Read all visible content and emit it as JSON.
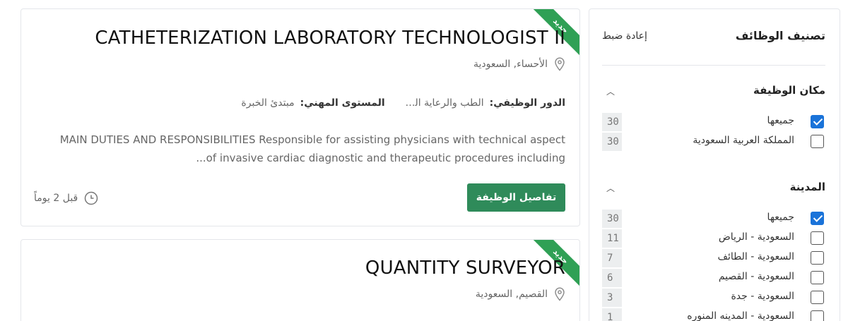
{
  "filters": {
    "title": "تصنيف الوظائف",
    "reset_label": "إعادة ضبط",
    "sections": [
      {
        "title": "مكان الوظيفة",
        "options": [
          {
            "label": "جميعها",
            "count": "30",
            "checked": true
          },
          {
            "label": "المملكة العربية السعودية",
            "count": "30",
            "checked": false
          }
        ]
      },
      {
        "title": "المدينة",
        "options": [
          {
            "label": "جميعها",
            "count": "30",
            "checked": true
          },
          {
            "label": "السعودية - الرياض",
            "count": "11",
            "checked": false
          },
          {
            "label": "السعودية - الطائف",
            "count": "7",
            "checked": false
          },
          {
            "label": "السعودية - القصيم",
            "count": "6",
            "checked": false
          },
          {
            "label": "السعودية - جدة",
            "count": "3",
            "checked": false
          },
          {
            "label": "السعودية - المدينه المنوره",
            "count": "1",
            "checked": false
          }
        ]
      }
    ]
  },
  "jobs": [
    {
      "badge": "جديد",
      "title": "CATHETERIZATION LABORATORY TECHNOLOGIST II",
      "location": "الأحساء, السعودية",
      "role_label": "الدور الوظيفي:",
      "role_value": "الطب والرعاية الصحية",
      "level_label": "المستوى المهني:",
      "level_value": "مبتدئ الخبرة",
      "description_line1": "MAIN DUTIES AND RESPONSIBILITIES  Responsible for assisting physicians with technical aspect",
      "description_line2": "of invasive cardiac diagnostic and therapeutic procedures including...",
      "details_button": "تفاصيل الوظيفة",
      "posted_ago": "قبل 2 يوماً"
    },
    {
      "badge": "جديد",
      "title": "QUANTITY SURVEYOR",
      "location": "القصيم, السعودية"
    }
  ],
  "colors": {
    "accent_green": "#2f8b5a",
    "ribbon_green": "#2fa055",
    "checkbox_blue": "#1a73d9"
  }
}
